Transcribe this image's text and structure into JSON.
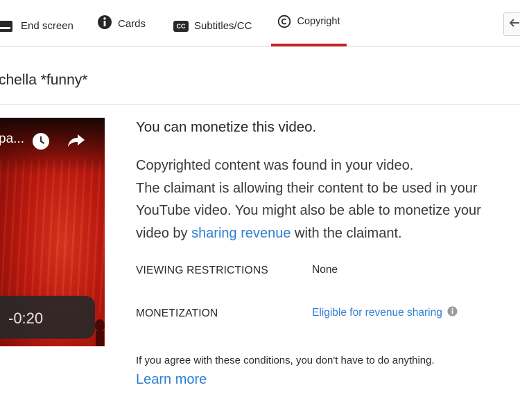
{
  "tabs": {
    "end_screen": "End screen",
    "cards": "Cards",
    "subtitles": "Subtitles/CC",
    "copyright": "Copyright",
    "subtitles_icon_text": "CC"
  },
  "video": {
    "title": "chella *funny*",
    "thumb_title": "pa...",
    "time": "-0:20"
  },
  "notice": {
    "heading": "You can monetize this video.",
    "line1": "Copyrighted content was found in your video.",
    "line2_pre": "The claimant is allowing their content to be used in your YouTube video. You might also be able to monetize your video by ",
    "line2_link": "sharing revenue",
    "line2_post": " with the claimant."
  },
  "details": {
    "viewing_label": "VIEWING RESTRICTIONS",
    "viewing_value": "None",
    "monetization_label": "MONETIZATION",
    "monetization_value": "Eligible for revenue sharing"
  },
  "footer": {
    "agree": "If you agree with these conditions, you don't have to do anything.",
    "learn_more": "Learn more"
  },
  "colors": {
    "accent_red": "#cc2222",
    "link_blue": "#2e7ed0"
  },
  "icons": {
    "end_screen": "end-screen-icon",
    "cards": "info-icon",
    "subtitles": "cc-icon",
    "copyright": "copyright-icon",
    "back": "arrow-left-icon",
    "clock": "clock-icon",
    "share": "share-icon",
    "info": "info-icon"
  }
}
